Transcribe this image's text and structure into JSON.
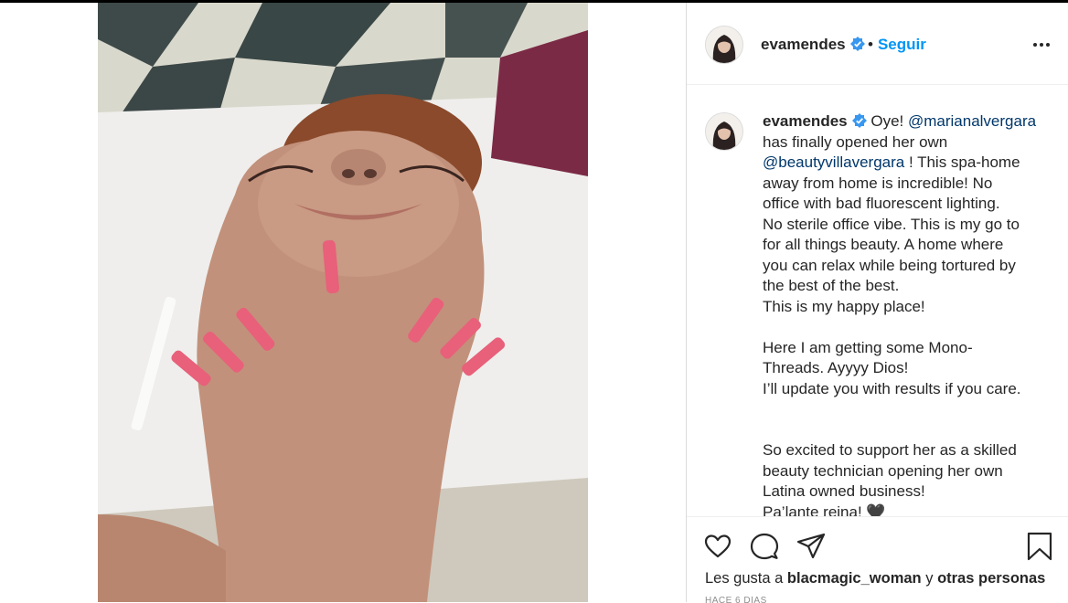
{
  "post": {
    "username": "evamendes",
    "follow_label": "Seguir",
    "dot": "•"
  },
  "caption": {
    "username": "evamendes",
    "seg1": " Oye! ",
    "mention1": "@marianalvergara",
    "seg2": "\nhas finally opened her own\n",
    "mention2": "@beautyvillavergara",
    "seg3": " ! This spa-home\naway from home is incredible! No\noffice with bad fluorescent lighting.\nNo sterile office vibe. This is my go to\nfor all things beauty. A home where\nyou can relax while being tortured by\nthe best of the best.\nThis is my happy place!\n\nHere I am getting some Mono-\nThreads. Ayyyy Dios!\nI’ll update you with results if you care.\n\n\nSo excited to support her as a skilled\nbeauty technician opening her own\nLatina owned business!\nPa’lante reina! 🖤"
  },
  "likes": {
    "prefix": "Les gusta a ",
    "user": "blacmagic_woman",
    "middle": " y ",
    "others": "otras personas"
  },
  "timestamp": "HACE 6 DÍAS",
  "icons": {
    "verified": "verified-badge-icon",
    "more": "more-options-icon",
    "like": "heart-icon",
    "comment": "comment-icon",
    "share": "paper-plane-icon",
    "save": "bookmark-icon"
  },
  "colors": {
    "accent": "#0095f6",
    "mention": "#00376b",
    "verified": "#3897f0"
  }
}
